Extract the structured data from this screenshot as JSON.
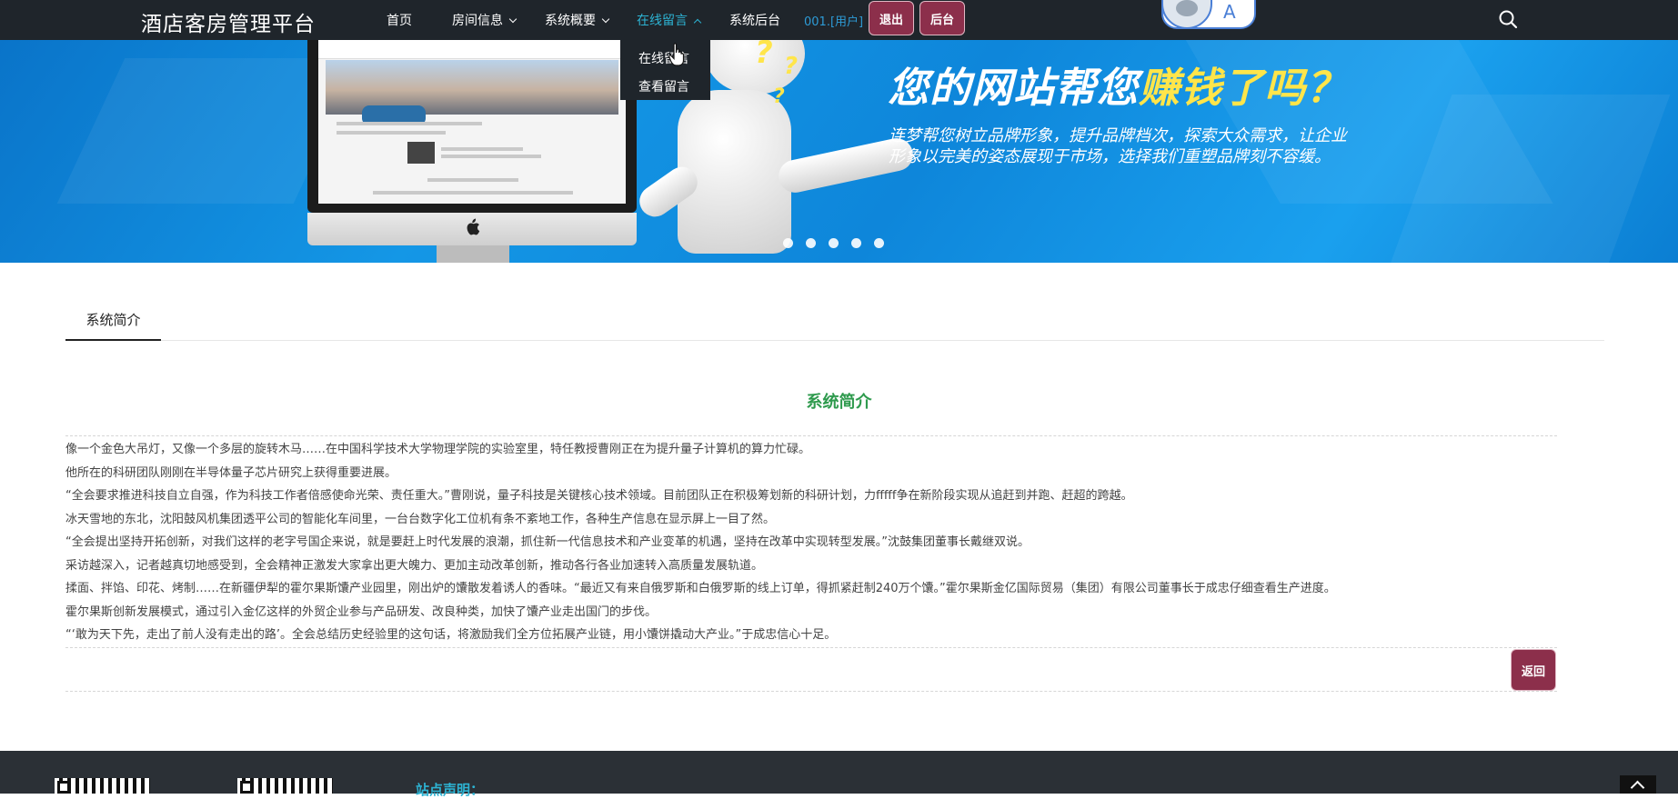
{
  "nav": {
    "brand": "酒店客房管理平台",
    "items": [
      {
        "label": "首页"
      },
      {
        "label": "房间信息"
      },
      {
        "label": "系统概要"
      },
      {
        "label": "在线留言"
      },
      {
        "label": "系统后台"
      }
    ],
    "user_tag": "001.[用户]",
    "logout_label": "退出",
    "admin_label": "后台",
    "avatar_letter": "A"
  },
  "dropdown": {
    "items": [
      {
        "label": "在线留言"
      },
      {
        "label": "查看留言"
      }
    ]
  },
  "banner": {
    "headline_prefix": "您的网站帮您",
    "headline_highlight": "赚钱了吗？",
    "subtext": "连梦帮您树立品牌形象，提升品牌档次，探索大众需求，让企业形象以完美的姿态展现于市场，选择我们重塑品牌刻不容缓。",
    "slide_count": 5
  },
  "tabs": [
    {
      "label": "系统简介"
    }
  ],
  "content": {
    "title": "系统简介",
    "paragraphs": [
      "像一个金色大吊灯，又像一个多层的旋转木马……在中国科学技术大学物理学院的实验室里，特任教授曹刚正在为提升量子计算机的算力忙碌。",
      "他所在的科研团队刚刚在半导体量子芯片研究上获得重要进展。",
      "“全会要求推进科技自立自强，作为科技工作者倍感使命光荣、责任重大。”曹刚说，量子科技是关键核心技术领域。目前团队正在积极筹划新的科研计划，力fffff争在新阶段实现从追赶到并跑、赶超的跨越。",
      "冰天雪地的东北，沈阳鼓风机集团透平公司的智能化车间里，一台台数字化工位机有条不紊地工作，各种生产信息在显示屏上一目了然。",
      "“全会提出坚持开拓创新，对我们这样的老字号国企来说，就是要赶上时代发展的浪潮，抓住新一代信息技术和产业变革的机遇，坚持在改革中实现转型发展。”沈鼓集团董事长戴继双说。",
      "采访越深入，记者越真切地感受到，全会精神正激发大家拿出更大魄力、更加主动改革创新，推动各行各业加速转入高质量发展轨道。",
      "揉面、拌馅、印花、烤制……在新疆伊犁的霍尔果斯馕产业园里，刚出炉的馕散发着诱人的香味。“最近又有来自俄罗斯和白俄罗斯的线上订单，得抓紧赶制240万个馕。”霍尔果斯金亿国际贸易（集团）有限公司董事长于成忠仔细查看生产进度。",
      "霍尔果斯创新发展模式，通过引入金亿这样的外贸企业参与产品研发、改良种类，加快了馕产业走出国门的步伐。",
      "“‘敢为天下先，走出了前人没有走出的路’。全会总结历史经验里的这句话，将激励我们全方位拓展产业链，用小馕饼撬动大产业。”于成忠信心十足。"
    ],
    "back_label": "返回"
  },
  "footer": {
    "notice_label": "站点声明："
  },
  "colors": {
    "nav_bg": "#1f252b",
    "nav_active": "#2db3d3",
    "button_bg": "#8c2f4b",
    "content_title": "#2e9a4d",
    "footer_bg": "#2b3036"
  }
}
